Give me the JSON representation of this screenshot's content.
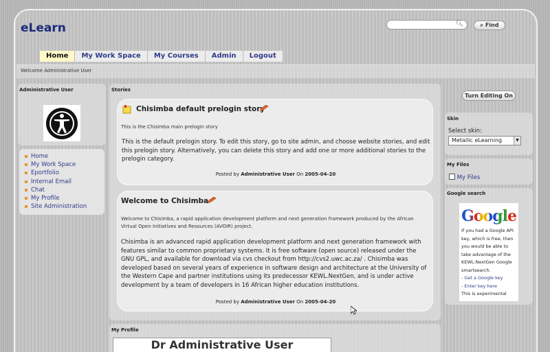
{
  "header": {
    "logo": "eLearn",
    "search_placeholder": "",
    "find_label": "Find"
  },
  "nav": {
    "items": [
      {
        "label": "Home",
        "active": true
      },
      {
        "label": "My Work Space"
      },
      {
        "label": "My Courses"
      },
      {
        "label": "Admin"
      },
      {
        "label": "Logout"
      }
    ]
  },
  "welcome": "Welcome Administrative User",
  "left": {
    "user_title": "Administrative User",
    "menu": [
      "Home",
      "My Work Space",
      "Eportfolio",
      "Internal Email",
      "Chat",
      "My Profile",
      "Site Administration"
    ]
  },
  "stories": {
    "title": "Stories",
    "items": [
      {
        "title": "Chisimba default prelogin story",
        "intro": "This is the Chisimba main prelogin story",
        "body": "This is the default prelogin story. To edit this story, go to site admin, and choose website stories, and edit this prelogin story. Alternatively, you can delete this story and add one or more additional stories to the prelogin category.",
        "posted_by": "Posted by",
        "author": "Administrative User",
        "on": "On",
        "date": "2005-04-20"
      },
      {
        "title": "Welcome to Chisimba",
        "intro": "Welcome to Chisimba, a rapid application development platform and next generation framework produced by the African Virtual Open Initiatives and Resources (AVOIR) project.",
        "body": "Chisimba is an advanced rapid application development platform and next generation framework with features similar to common proprietary systems. It is free software (open source) released under the GNU GPL, and available for download via cvs checkout from http://cvs2.uwc.ac.za/ . Chisimba was developed based on several years of experience in software design and architecture at the University of the Western Cape and partner institutions using its predecessor KEWL.NextGen, and is under active development by a team of developers in 16 African higher education institutions.",
        "posted_by": "Posted by",
        "author": "Administrative User",
        "on": "On",
        "date": "2005-04-20"
      }
    ]
  },
  "profile": {
    "title": "My Profile",
    "name": "Dr Administrative User"
  },
  "right": {
    "edit_button": "Turn Editing On",
    "skin_title": "Skin",
    "select_label": "Select skin:",
    "skin_value": "Metallic eLearning",
    "files_title": "My Files",
    "files_link": "My Files",
    "google_title": "Google search",
    "google_logo": "Google",
    "google_text": "If you had a Google API key, which is free, then you would be able to take advantage of the KEWL.NextGen Google smartsearch.",
    "google_link1": "- Get a Google key",
    "google_link2": "- Enter key here",
    "google_note": "This is experimental"
  }
}
